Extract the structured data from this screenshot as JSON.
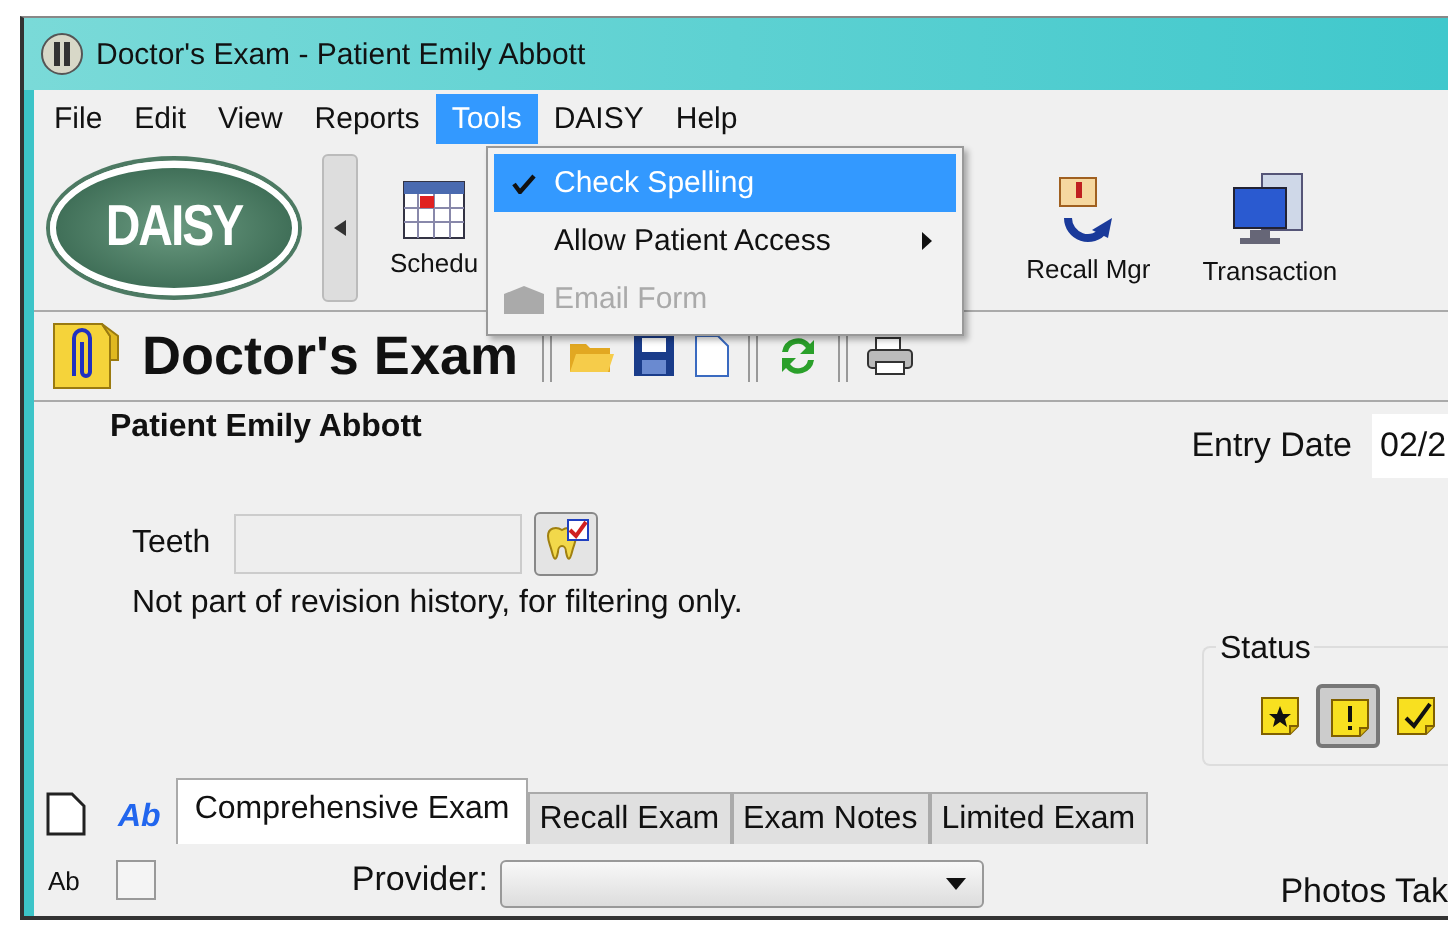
{
  "window": {
    "title": "Doctor's Exam - Patient Emily Abbott"
  },
  "menu_bar": [
    {
      "label": "File",
      "selected": false
    },
    {
      "label": "Edit",
      "selected": false
    },
    {
      "label": "View",
      "selected": false
    },
    {
      "label": "Reports",
      "selected": false
    },
    {
      "label": "Tools",
      "selected": true
    },
    {
      "label": "DAISY",
      "selected": false
    },
    {
      "label": "Help",
      "selected": false
    }
  ],
  "tools_menu": [
    {
      "label": "Check Spelling",
      "kind": "check",
      "checked": true,
      "selected": true,
      "disabled": false
    },
    {
      "label": "Allow Patient Access",
      "kind": "submenu",
      "checked": false,
      "selected": false,
      "disabled": false
    },
    {
      "label": "Email Form",
      "kind": "icon",
      "checked": false,
      "selected": false,
      "disabled": true
    }
  ],
  "toolbar": {
    "logo": "DAISY",
    "items": [
      {
        "label": "Schedu",
        "kind": "calendar"
      },
      {
        "label": "Recall Mgr",
        "kind": "recall"
      },
      {
        "label": "Transaction",
        "kind": "monitor"
      }
    ]
  },
  "form": {
    "title": "Doctor's Exam",
    "patient": "Patient Emily Abbott",
    "entry_date": {
      "label": "Entry Date",
      "value": "02/2"
    },
    "teeth": {
      "label": "Teeth"
    },
    "note": "Not part of revision history, for filtering only.",
    "status": {
      "label": "Status",
      "buttons": [
        {
          "kind": "star",
          "selected": false
        },
        {
          "kind": "alert",
          "selected": true
        },
        {
          "kind": "check",
          "selected": false
        }
      ]
    },
    "side_tools": {
      "format_label": "Ab",
      "plain_label": "Ab",
      "checked": false
    },
    "tabs": [
      {
        "label": "Comprehensive Exam",
        "selected": true
      },
      {
        "label": "Recall Exam",
        "selected": false
      },
      {
        "label": "Exam Notes",
        "selected": false
      },
      {
        "label": "Limited Exam",
        "selected": false
      }
    ],
    "provider": {
      "label": "Provider:"
    },
    "photos_label": "Photos Tak"
  }
}
